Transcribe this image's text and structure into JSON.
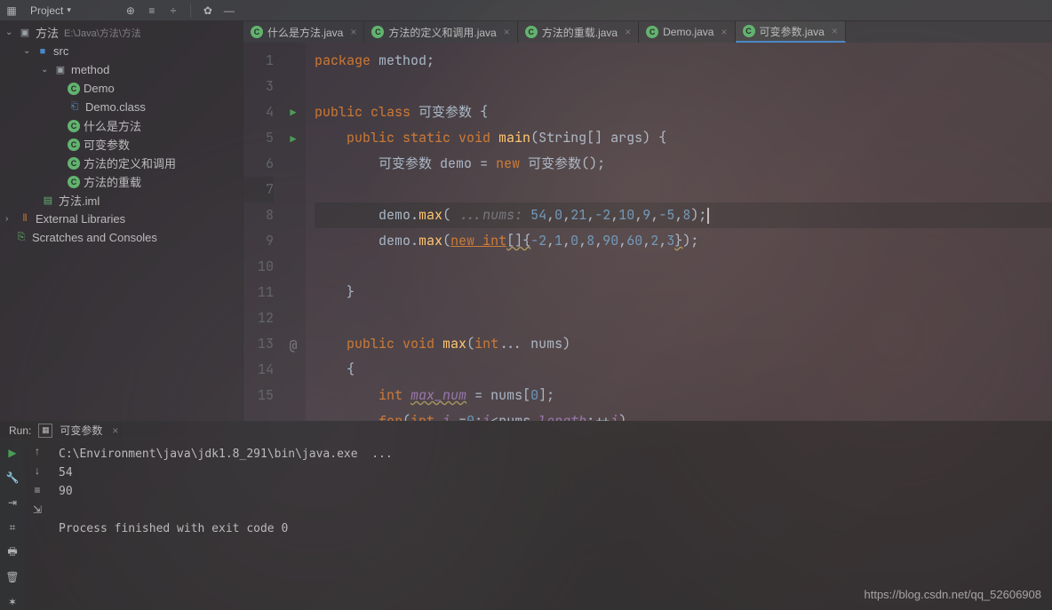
{
  "toolbar": {
    "project_label": "Project"
  },
  "tree": {
    "root": {
      "name": "方法",
      "path": "E:\\Java\\方法\\方法"
    },
    "src": "src",
    "pkg": "method",
    "files": [
      "Demo",
      "Demo.class",
      "什么是方法",
      "可变参数",
      "方法的定义和调用",
      "方法的重载"
    ],
    "iml": "方法.iml",
    "ext_lib": "External Libraries",
    "scratches": "Scratches and Consoles"
  },
  "tabs": [
    {
      "name": "什么是方法.java"
    },
    {
      "name": "方法的定义和调用.java"
    },
    {
      "name": "方法的重载.java"
    },
    {
      "name": "Demo.java"
    },
    {
      "name": "可变参数.java",
      "active": true
    }
  ],
  "code": {
    "lines": [
      "1",
      "",
      "3",
      "4",
      "5",
      "6",
      "7",
      "8",
      "9",
      "10",
      "11",
      "12",
      "13",
      "14",
      "15"
    ]
  },
  "run": {
    "label": "Run:",
    "config": "可变参数",
    "output": "C:\\Environment\\java\\jdk1.8_291\\bin\\java.exe  ...\n54\n90\n\nProcess finished with exit code 0"
  },
  "watermark": "https://blog.csdn.net/qq_52606908"
}
